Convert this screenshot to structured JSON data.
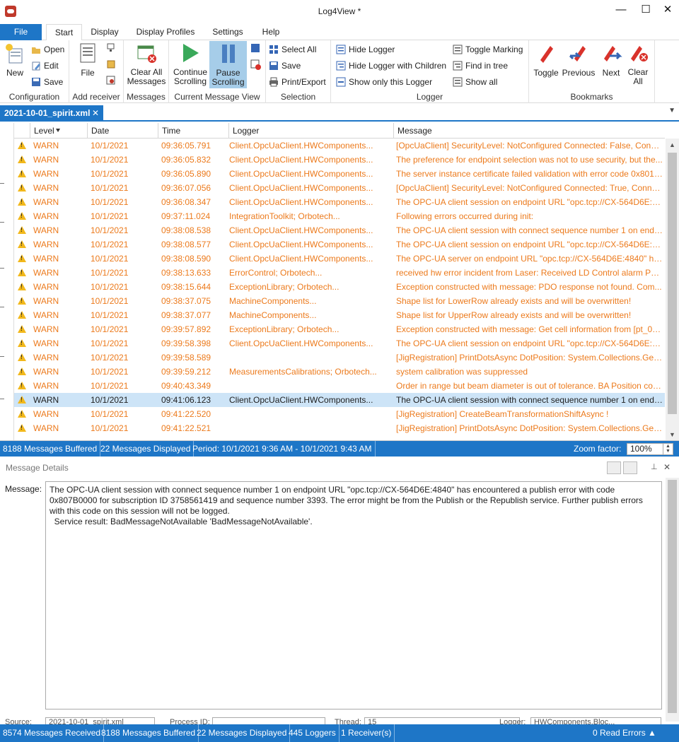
{
  "window": {
    "title": "Log4View *",
    "min": "—",
    "max": "☐",
    "close": "✕"
  },
  "ribbon_tabs": [
    "File",
    "Start",
    "Display",
    "Display Profiles",
    "Settings",
    "Help"
  ],
  "ribbon": {
    "configuration": {
      "label": "Configuration",
      "new": "New",
      "open": "Open",
      "edit": "Edit",
      "save": "Save"
    },
    "add_receiver": {
      "label": "Add receiver",
      "file": "File"
    },
    "messages": {
      "label": "Messages",
      "clear_all": "Clear All Messages"
    },
    "current_view": {
      "label": "Current Message View",
      "continue": "Continue Scrolling",
      "pause": "Pause Scrolling"
    },
    "selection": {
      "label": "Selection",
      "select_all": "Select All",
      "save": "Save",
      "print_export": "Print/Export"
    },
    "logger": {
      "label": "Logger",
      "hide_logger": "Hide Logger",
      "hide_children": "Hide Logger with Children",
      "show_only": "Show only this Logger",
      "toggle_marking": "Toggle Marking",
      "find_in_tree": "Find in tree",
      "show_all": "Show all"
    },
    "bookmarks": {
      "label": "Bookmarks",
      "toggle": "Toggle",
      "previous": "Previous",
      "next": "Next",
      "clear_all": "Clear All"
    }
  },
  "document_tab": {
    "name": "2021-10-01_spirit.xml",
    "close": "✕"
  },
  "grid": {
    "columns": [
      "Level",
      "Date",
      "Time",
      "Logger",
      "Message"
    ],
    "rows": [
      {
        "level": "WARN",
        "date": "10/1/2021",
        "time": "09:36:05.791",
        "logger": "Client.OpcUaClient.HWComponents...",
        "message": "[OpcUaClient] SecurityLevel: NotConfigured Connected: False, Conne..."
      },
      {
        "level": "WARN",
        "date": "10/1/2021",
        "time": "09:36:05.832",
        "logger": "Client.OpcUaClient.HWComponents...",
        "message": "The preference for endpoint selection was not to use security, but the..."
      },
      {
        "level": "WARN",
        "date": "10/1/2021",
        "time": "09:36:05.890",
        "logger": "Client.OpcUaClient.HWComponents...",
        "message": "The server instance certificate failed validation with error code 0x801A..."
      },
      {
        "level": "WARN",
        "date": "10/1/2021",
        "time": "09:36:07.056",
        "logger": "Client.OpcUaClient.HWComponents...",
        "message": "[OpcUaClient] SecurityLevel: NotConfigured Connected: True, Conne..."
      },
      {
        "level": "WARN",
        "date": "10/1/2021",
        "time": "09:36:08.347",
        "logger": "Client.OpcUaClient.HWComponents...",
        "message": "The OPC-UA client session on endpoint URL \"opc.tcp://CX-564D6E:48..."
      },
      {
        "level": "WARN",
        "date": "10/1/2021",
        "time": "09:37:11.024",
        "logger": "IntegrationToolkit; Orbotech...",
        "message": "Following errors occurred during init:"
      },
      {
        "level": "WARN",
        "date": "10/1/2021",
        "time": "09:38:08.538",
        "logger": "Client.OpcUaClient.HWComponents...",
        "message": "The OPC-UA client session with connect sequence number 1 on endp..."
      },
      {
        "level": "WARN",
        "date": "10/1/2021",
        "time": "09:38:08.577",
        "logger": "Client.OpcUaClient.HWComponents...",
        "message": "The OPC-UA client session on endpoint URL \"opc.tcp://CX-564D6E:48..."
      },
      {
        "level": "WARN",
        "date": "10/1/2021",
        "time": "09:38:08.590",
        "logger": "Client.OpcUaClient.HWComponents...",
        "message": "The OPC-UA server on endpoint URL \"opc.tcp://CX-564D6E:4840\" has..."
      },
      {
        "level": "WARN",
        "date": "10/1/2021",
        "time": "09:38:13.633",
        "logger": "ErrorControl; Orbotech...",
        "message": "received hw error incident from Laser: Received LD Control alarm PDO:"
      },
      {
        "level": "WARN",
        "date": "10/1/2021",
        "time": "09:38:15.644",
        "logger": "ExceptionLibrary; Orbotech...",
        "message": "Exception constructed with message: PDO response not found. Com..."
      },
      {
        "level": "WARN",
        "date": "10/1/2021",
        "time": "09:38:37.075",
        "logger": "MachineComponents...",
        "message": "Shape list for LowerRow already exists and will be overwritten!"
      },
      {
        "level": "WARN",
        "date": "10/1/2021",
        "time": "09:38:37.077",
        "logger": "MachineComponents...",
        "message": "Shape list for UpperRow already exists and will be overwritten!"
      },
      {
        "level": "WARN",
        "date": "10/1/2021",
        "time": "09:39:57.892",
        "logger": "ExceptionLibrary; Orbotech...",
        "message": "Exception constructed with message: Get cell information from [pt_0_..."
      },
      {
        "level": "WARN",
        "date": "10/1/2021",
        "time": "09:39:58.398",
        "logger": "Client.OpcUaClient.HWComponents...",
        "message": "The OPC-UA client session on endpoint URL \"opc.tcp://CX-564D6E:48..."
      },
      {
        "level": "WARN",
        "date": "10/1/2021",
        "time": "09:39:58.589",
        "logger": "",
        "message": "[JigRegistration] PrintDotsAsync DotPosition: System.Collections.Gen..."
      },
      {
        "level": "WARN",
        "date": "10/1/2021",
        "time": "09:39:59.212",
        "logger": "MeasurementsCalibrations; Orbotech...",
        "message": "system calibration was suppressed"
      },
      {
        "level": "WARN",
        "date": "10/1/2021",
        "time": "09:40:43.349",
        "logger": "",
        "message": "Order in range but beam diameter is out of tolerance. BA Position corr..."
      },
      {
        "level": "WARN",
        "date": "10/1/2021",
        "time": "09:41:06.123",
        "logger": "Client.OpcUaClient.HWComponents...",
        "message": "The OPC-UA client session with connect sequence number 1 on endp...",
        "selected": true
      },
      {
        "level": "WARN",
        "date": "10/1/2021",
        "time": "09:41:22.520",
        "logger": "",
        "message": "[JigRegistration] CreateBeamTransformationShiftAsync !"
      },
      {
        "level": "WARN",
        "date": "10/1/2021",
        "time": "09:41:22.521",
        "logger": "",
        "message": "[JigRegistration] PrintDotsAsync DotPosition: System.Collections.Gen..."
      }
    ]
  },
  "status_top": {
    "buffered": "8188 Messages Buffered",
    "displayed": "22 Messages Displayed",
    "period": "Period: 10/1/2021 9:36 AM - 10/1/2021 9:43 AM",
    "zoom_label": "Zoom factor:",
    "zoom_value": "100%"
  },
  "details": {
    "title": "Message Details",
    "message_label": "Message:",
    "message_text": "The OPC-UA client session with connect sequence number 1 on endpoint URL \"opc.tcp://CX-564D6E:4840\" has encountered a publish error with code 0x807B0000 for subscription ID 3758561419 and sequence number 3393. The error might be from the Publish or the Republish service. Further publish errors with this code on this session will not be logged.\n  Service result: BadMessageNotAvailable 'BadMessageNotAvailable'.",
    "source_label": "Source:",
    "source_value": "2021-10-01_spirit.xml",
    "process_label": "Process ID:",
    "thread_label": "Thread:",
    "thread_value": "15",
    "logger_label": "Logger:",
    "logger_value": "HWComponents.Bloc..."
  },
  "status_bottom": {
    "received": "8574 Messages Received",
    "buffered": "8188 Messages Buffered",
    "displayed": "22 Messages Displayed",
    "loggers": "445 Loggers",
    "receivers": "1 Receiver(s)",
    "read_errors": "0 Read Errors ▲"
  },
  "colors": {
    "accent": "#1e76c7",
    "warn_text": "#ec7a1c",
    "selected_row": "#cde4f7",
    "warn_icon": "#f2b81b"
  }
}
